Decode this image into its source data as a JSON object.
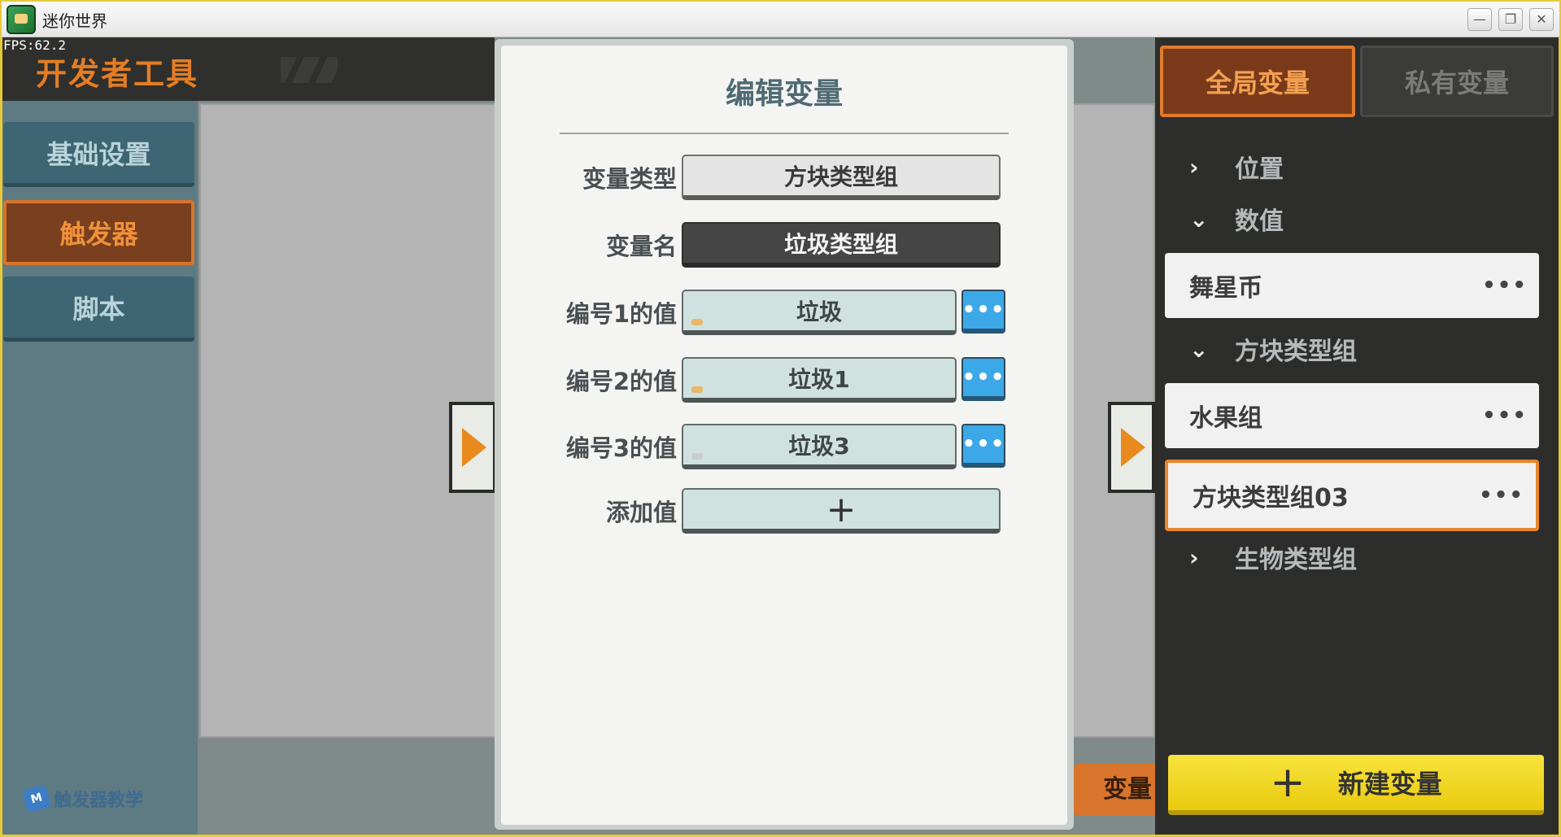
{
  "window": {
    "title": "迷你世界",
    "fps": "FPS:62.2",
    "minimize": "—",
    "restore": "❐",
    "close": "✕"
  },
  "header": {
    "title": "开发者工具"
  },
  "sidebar": {
    "items": [
      {
        "label": "基础设置",
        "active": false
      },
      {
        "label": "触发器",
        "active": true
      },
      {
        "label": "脚本",
        "active": false
      }
    ],
    "tutorial_label": "触发器教学",
    "tutorial_icon": "M"
  },
  "dialog": {
    "title": "编辑变量",
    "rows": [
      {
        "label": "变量类型",
        "value": "方块类型组"
      },
      {
        "label": "变量名",
        "value": "垃圾类型组"
      },
      {
        "label": "编号1的值",
        "value": "垃圾"
      },
      {
        "label": "编号2的值",
        "value": "垃圾1"
      },
      {
        "label": "编号3的值",
        "value": "垃圾3"
      },
      {
        "label": "添加值",
        "value": "+"
      }
    ],
    "more_glyph": "•••"
  },
  "var_tab_label": "变量",
  "right_panel": {
    "tabs": [
      {
        "label": "全局变量",
        "active": true
      },
      {
        "label": "私有变量",
        "active": false
      }
    ],
    "groups": [
      {
        "label": "位置",
        "expanded": false,
        "chevron": "›"
      },
      {
        "label": "数值",
        "expanded": true,
        "chevron": "⌄",
        "items": [
          "舞星币"
        ]
      },
      {
        "label": "方块类型组",
        "expanded": true,
        "chevron": "⌄",
        "items": [
          "水果组",
          "方块类型组03"
        ],
        "selected": "方块类型组03"
      },
      {
        "label": "生物类型组",
        "expanded": false,
        "chevron": "›"
      }
    ],
    "more_glyph": "•••",
    "new_button": {
      "icon": "+",
      "label": "新建变量"
    }
  },
  "colors": {
    "accent_orange": "#e27a2b",
    "button_blue": "#3da8e8",
    "new_button_yellow": "#f5de30",
    "dark_panel": "#2d2d2b"
  }
}
